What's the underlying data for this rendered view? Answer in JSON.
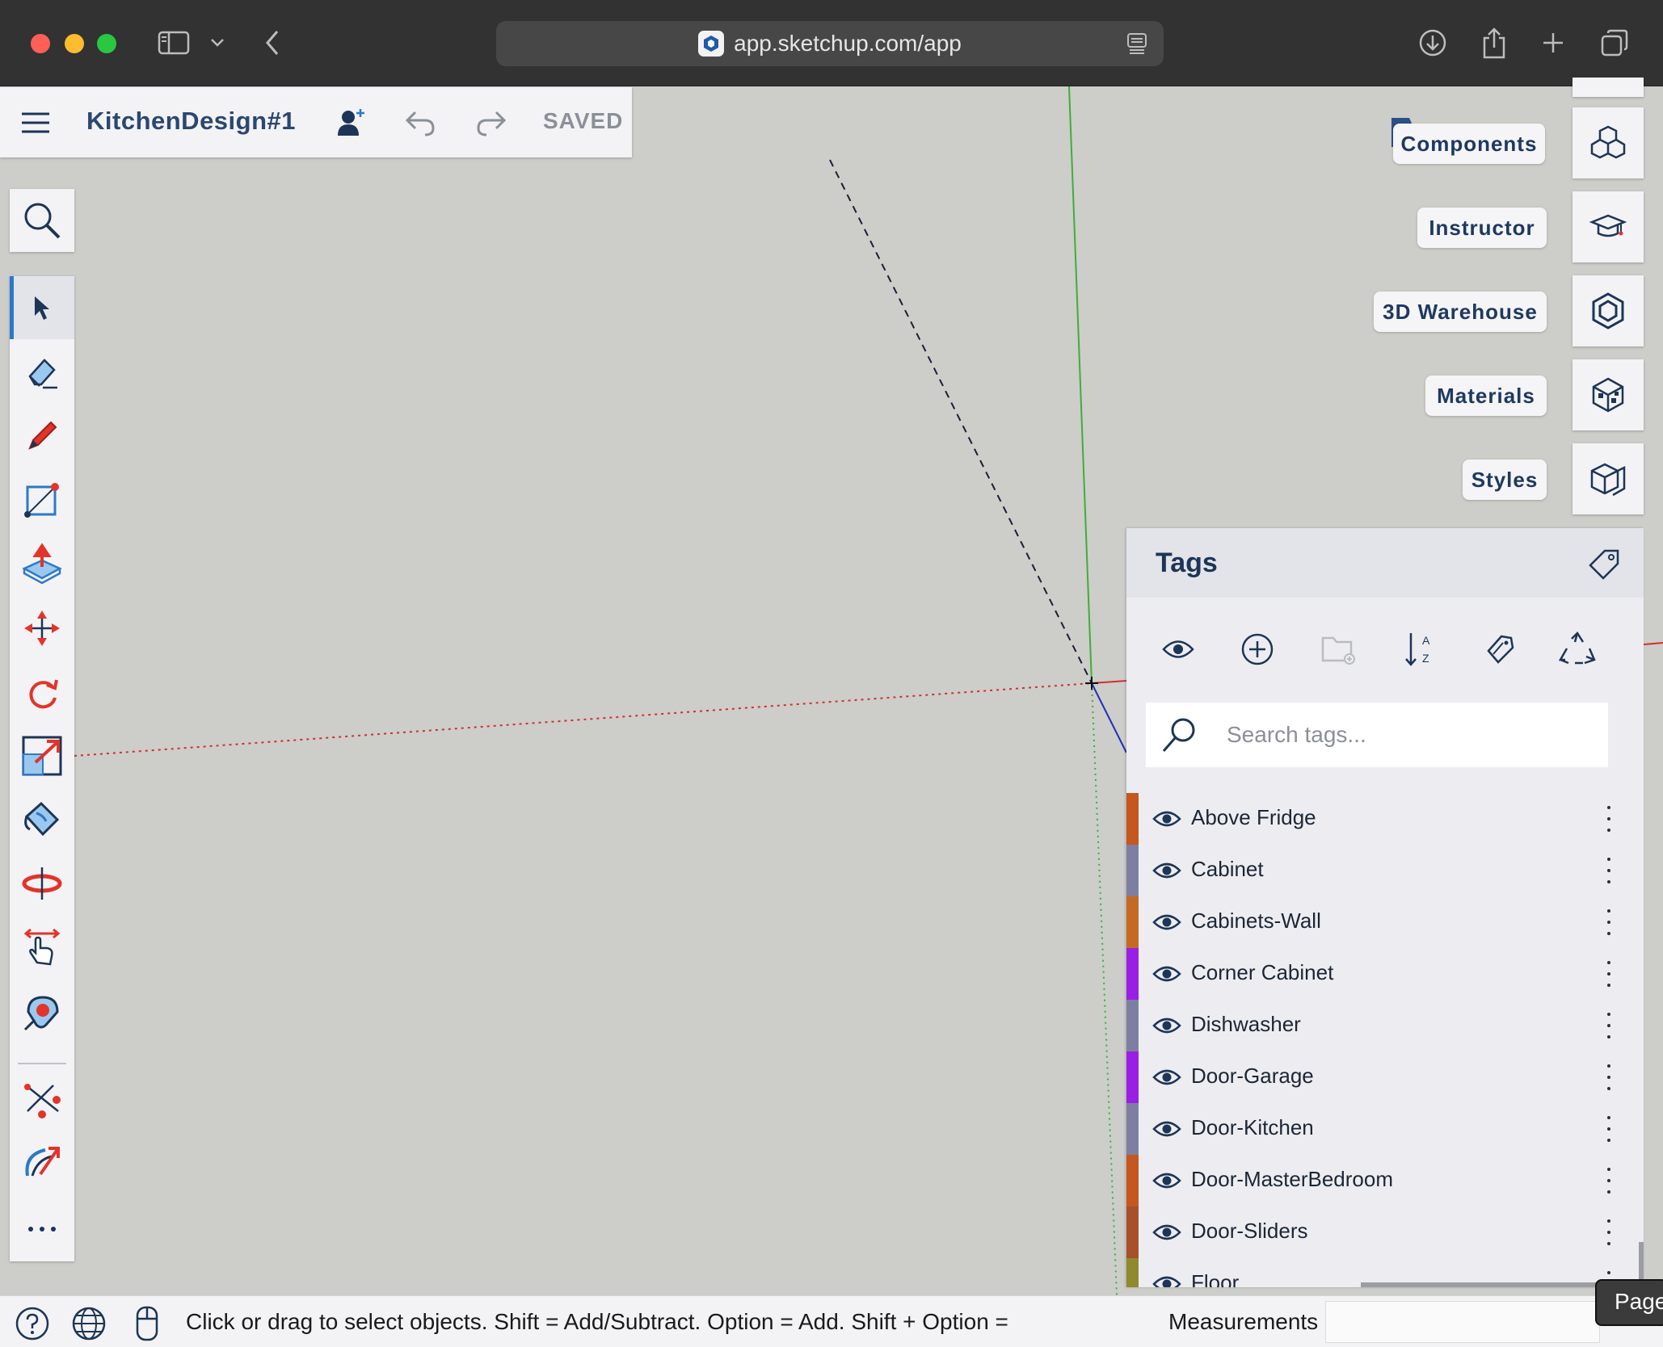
{
  "browser": {
    "url": "app.sketchup.com/app",
    "traffic_colors": {
      "close": "#fe5f57",
      "minimize": "#febc2e",
      "maximize": "#28c840"
    }
  },
  "appbar": {
    "title": "KitchenDesign#1",
    "saved_label": "SAVED"
  },
  "tools": [
    "search",
    "select",
    "eraser",
    "pencil",
    "rectangle",
    "push-pull",
    "move",
    "rotate",
    "scale",
    "paint-bucket",
    "orbit",
    "pan",
    "zoom-extents",
    "dimension",
    "follow-me",
    "more"
  ],
  "right_panel": {
    "items": [
      {
        "label": "Components",
        "icon": "components-icon"
      },
      {
        "label": "Instructor",
        "icon": "instructor-icon"
      },
      {
        "label": "3D Warehouse",
        "icon": "warehouse-icon"
      },
      {
        "label": "Materials",
        "icon": "materials-icon"
      },
      {
        "label": "Styles",
        "icon": "styles-icon"
      }
    ]
  },
  "tags_panel": {
    "title": "Tags",
    "search_placeholder": "Search tags...",
    "tags": [
      {
        "name": "Above Fridge",
        "color": "#c4581f"
      },
      {
        "name": "Cabinet",
        "color": "#7e7fa0"
      },
      {
        "name": "Cabinets-Wall",
        "color": "#c56a23"
      },
      {
        "name": "Corner Cabinet",
        "color": "#9a1fe4"
      },
      {
        "name": "Dishwasher",
        "color": "#7e7fa0"
      },
      {
        "name": "Door-Garage",
        "color": "#9a1fe4"
      },
      {
        "name": "Door-Kitchen",
        "color": "#7e7fa0"
      },
      {
        "name": "Door-MasterBedroom",
        "color": "#c4581f"
      },
      {
        "name": "Door-Sliders",
        "color": "#a8502a"
      },
      {
        "name": "Floor",
        "color": "#8f8a2d"
      }
    ]
  },
  "status_bar": {
    "message": "Click or drag to select objects. Shift = Add/Subtract. Option = Add. Shift + Option =",
    "measurements_label": "Measurements",
    "page_tab": "Page"
  },
  "colors": {
    "accent_blue": "#2c79c8",
    "tool_red": "#e2342a",
    "canvas": "#cdcdca",
    "panel": "#ededf1"
  }
}
